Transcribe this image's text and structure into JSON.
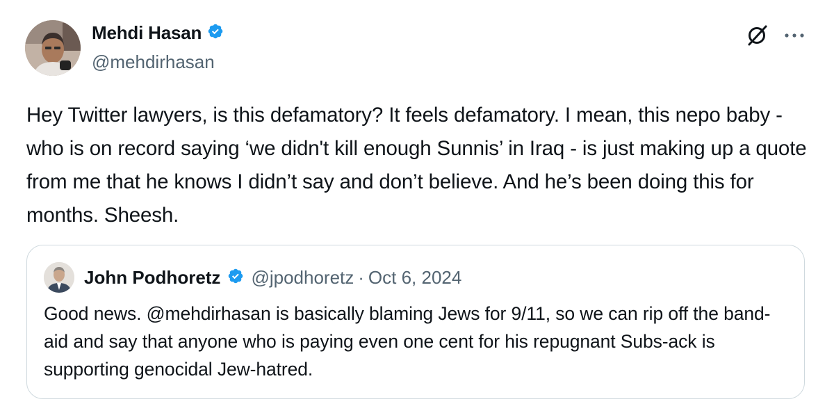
{
  "tweet": {
    "author": {
      "name": "Mehdi Hasan",
      "handle": "@mehdirhasan",
      "verified_icon": "verified-badge-icon",
      "avatar_icon": "avatar-photo"
    },
    "actions": {
      "grok_icon": "grok-icon",
      "more_icon": "more-icon"
    },
    "text": "Hey Twitter lawyers, is this defamatory? It feels defamatory. I mean, this nepo baby - who is on record saying ‘we didn't kill enough Sunnis’ in Iraq - is just making up a quote from me that he knows I didn’t say and don’t believe. And he’s been doing this for months. Sheesh.",
    "quote": {
      "author": {
        "name": "John Podhoretz",
        "handle": "@jpodhoretz",
        "verified_icon": "verified-badge-icon"
      },
      "separator": "·",
      "date": "Oct 6, 2024",
      "text": "Good news. @mehdirhasan is basically blaming Jews for 9/11, so we can rip off the band-aid and say that anyone who is paying even one cent for his repugnant Subs-ack is supporting genocidal Jew-hatred."
    }
  },
  "colors": {
    "text_primary": "#0f1419",
    "text_secondary": "#536471",
    "verified_blue": "#1d9bf0",
    "border": "#cfd9de"
  }
}
